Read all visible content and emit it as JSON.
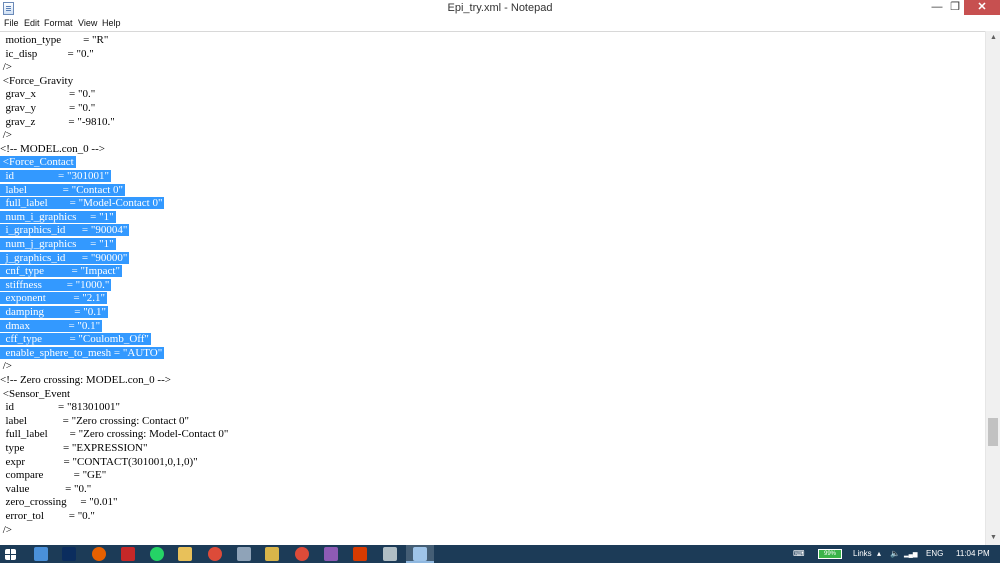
{
  "window": {
    "title": "Epi_try.xml - Notepad",
    "minimize_glyph": "—",
    "maximize_glyph": "❐",
    "close_glyph": "✕"
  },
  "menu": [
    "File",
    "Edit",
    "Format",
    "View",
    "Help"
  ],
  "editor": {
    "lines": [
      {
        "text": "  motion_type        = \"R\"",
        "selected": false
      },
      {
        "text": "  ic_disp           = \"0.\"",
        "selected": false
      },
      {
        "text": " />",
        "selected": false
      },
      {
        "text": " <Force_Gravity",
        "selected": false
      },
      {
        "text": "  grav_x            = \"0.\"",
        "selected": false
      },
      {
        "text": "  grav_y            = \"0.\"",
        "selected": false
      },
      {
        "text": "  grav_z            = \"-9810.\"",
        "selected": false
      },
      {
        "text": " />",
        "selected": false
      },
      {
        "text": "<!-- MODEL.con_0 -->",
        "selected": false
      },
      {
        "text": " <Force_Contact",
        "selected": true
      },
      {
        "text": "  id                = \"301001\"",
        "selected": true
      },
      {
        "text": "  label             = \"Contact 0\"",
        "selected": true
      },
      {
        "text": "  full_label        = \"Model-Contact 0\"",
        "selected": true
      },
      {
        "text": "  num_i_graphics     = \"1\"",
        "selected": true
      },
      {
        "text": "  i_graphics_id      = \"90004\"",
        "selected": true
      },
      {
        "text": "  num_j_graphics     = \"1\"",
        "selected": true
      },
      {
        "text": "  j_graphics_id      = \"90000\"",
        "selected": true
      },
      {
        "text": "  cnf_type          = \"Impact\"",
        "selected": true
      },
      {
        "text": "  stiffness         = \"1000.\"",
        "selected": true
      },
      {
        "text": "  exponent          = \"2.1\"",
        "selected": true
      },
      {
        "text": "  damping           = \"0.1\"",
        "selected": true
      },
      {
        "text": "  dmax              = \"0.1\"",
        "selected": true
      },
      {
        "text": "  cff_type          = \"Coulomb_Off\"",
        "selected": true
      },
      {
        "text": "  enable_sphere_to_mesh = \"AUTO\"",
        "selected": true
      },
      {
        "text": " />",
        "selected": false
      },
      {
        "text": "<!-- Zero crossing: MODEL.con_0 -->",
        "selected": false
      },
      {
        "text": " <Sensor_Event",
        "selected": false
      },
      {
        "text": "  id                = \"81301001\"",
        "selected": false
      },
      {
        "text": "  label             = \"Zero crossing: Contact 0\"",
        "selected": false
      },
      {
        "text": "  full_label        = \"Zero crossing: Model-Contact 0\"",
        "selected": false
      },
      {
        "text": "  type              = \"EXPRESSION\"",
        "selected": false
      },
      {
        "text": "  expr              = \"CONTACT(301001,0,1,0)\"",
        "selected": false
      },
      {
        "text": "  compare           = \"GE\"",
        "selected": false
      },
      {
        "text": "  value             = \"0.\"",
        "selected": false
      },
      {
        "text": "  zero_crossing     = \"0.01\"",
        "selected": false
      },
      {
        "text": "  error_tol         = \"0.\"",
        "selected": false
      },
      {
        "text": " />",
        "selected": false
      }
    ]
  },
  "scrollbar": {
    "up_glyph": "▲",
    "down_glyph": "▼"
  },
  "taskbar": {
    "battery_text": "99%",
    "battery_level": 0.99,
    "links_label": "Links",
    "tray_arrow": "▴",
    "volume_glyph": "🔈",
    "signal_glyph": "▂▄▆",
    "language": "ENG",
    "time": "11:04 PM",
    "keyboard_glyph": "⌨",
    "icons": [
      {
        "name": "start-icon",
        "color": "#ffffff"
      },
      {
        "name": "explorer-window-icon",
        "color": "#4a90d9"
      },
      {
        "name": "photoshop-icon",
        "color": "#0b2d5e"
      },
      {
        "name": "firefox-icon",
        "color": "#e66000"
      },
      {
        "name": "app-red-icon",
        "color": "#c62828"
      },
      {
        "name": "whatsapp-icon",
        "color": "#25d366"
      },
      {
        "name": "folder-icon",
        "color": "#e8c15a"
      },
      {
        "name": "chrome-icon",
        "color": "#dd4b39"
      },
      {
        "name": "network-app-icon",
        "color": "#8fa3b8"
      },
      {
        "name": "files-icon",
        "color": "#d9b54a"
      },
      {
        "name": "chrome-2-icon",
        "color": "#dd4b39"
      },
      {
        "name": "visual-studio-icon",
        "color": "#8e5bb5"
      },
      {
        "name": "office-icon",
        "color": "#d83b01"
      },
      {
        "name": "tool-icon",
        "color": "#b0bec5"
      },
      {
        "name": "notepad-icon",
        "color": "#9fc4e8"
      }
    ]
  },
  "colors": {
    "selection": "#3399ff",
    "taskbar": "#1c3b57",
    "close_button": "#c75050"
  }
}
